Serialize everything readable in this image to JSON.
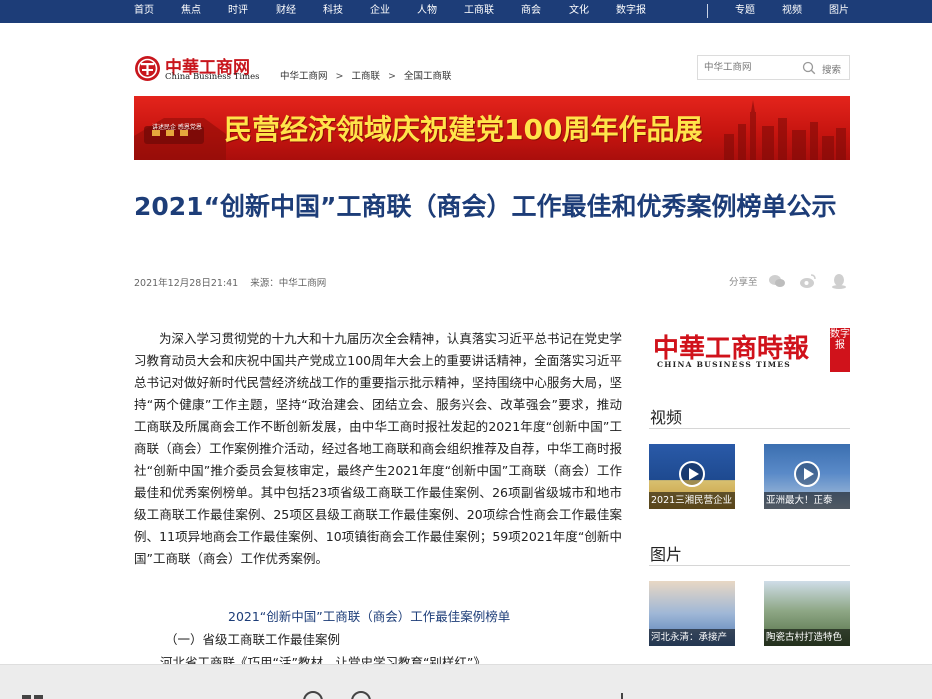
{
  "topnav": {
    "left_items": [
      "首页",
      "焦点",
      "时评",
      "财经",
      "科技",
      "企业",
      "人物",
      "工商联",
      "商会",
      "文化",
      "数字报"
    ],
    "separator": "|",
    "right_items": [
      "专题",
      "视频",
      "图片"
    ],
    "bg_color": "#1d3d78"
  },
  "header": {
    "logo_cn": "中華工商网",
    "logo_en": "China Business Times",
    "breadcrumb": [
      "中华工商网",
      "工商联",
      "全国工商联"
    ],
    "breadcrumb_sep": ">",
    "search_placeholder": "中华工商网",
    "search_label": "搜索"
  },
  "banner": {
    "text": "民营经济领域庆祝建党100周年作品展",
    "small_text": "讲述民企 感恩党恩"
  },
  "article": {
    "title": "2021“创新中国”工商联（商会）工作最佳和优秀案例榜单公示",
    "date": "2021年12月28日21:41",
    "source": "来源：中华工商网",
    "share_label": "分享至",
    "share_icons": [
      "wechat-icon",
      "weibo-icon",
      "qq-icon"
    ],
    "body": "为深入学习贯彻党的十九大和十九届历次全会精神，认真落实习近平总书记在党史学习教育动员大会和庆祝中国共产党成立100周年大会上的重要讲话精神，全面落实习近平总书记对做好新时代民营经济统战工作的重要指示批示精神，坚持围绕中心服务大局，坚持“两个健康”工作主题，坚持“政治建会、团结立会、服务兴会、改革强会”要求，推动工商联及所属商会工作不断创新发展，由中华工商时报社发起的2021年度“创新中国”工商联（商会）工作案例推介活动，经过各地工商联和商会组织推荐及自荐，中华工商时报社“创新中国”推介委员会复核审定，最终产生2021年度“创新中国”工商联（商会）工作最佳和优秀案例榜单。其中包括23项省级工商联工作最佳案例、26项副省级城市和地市级工商联工作最佳案例、25项区县级工商联工作最佳案例、20项综合性商会工作最佳案例、11项异地商会工作最佳案例、10项镇街商会工作最佳案例；59项2021年度“创新中国”工商联（商会）工作优秀案例。",
    "subhead": "2021“创新中国”工商联（商会）工作最佳案例榜单",
    "section1": "（一）省级工商联工作最佳案例",
    "item1": "河北省工商联《巧用“活”教材，让党史学习教育“别样红”》"
  },
  "sidebar": {
    "paper_cn": "中華工商時報",
    "paper_en": "CHINA BUSINESS TIMES",
    "paper_tag": "数字报",
    "video_title": "视频",
    "videos": [
      {
        "caption": "2021三湘民营企业"
      },
      {
        "caption": "亚洲最大！正泰"
      }
    ],
    "photo_title": "图片",
    "photos": [
      {
        "caption": "河北永清：承接产"
      },
      {
        "caption": "陶瓷古村打造特色"
      }
    ]
  },
  "colors": {
    "accent_blue": "#1d3d78",
    "brand_red": "#c8161d",
    "banner_yellow": "#ffe44a"
  }
}
